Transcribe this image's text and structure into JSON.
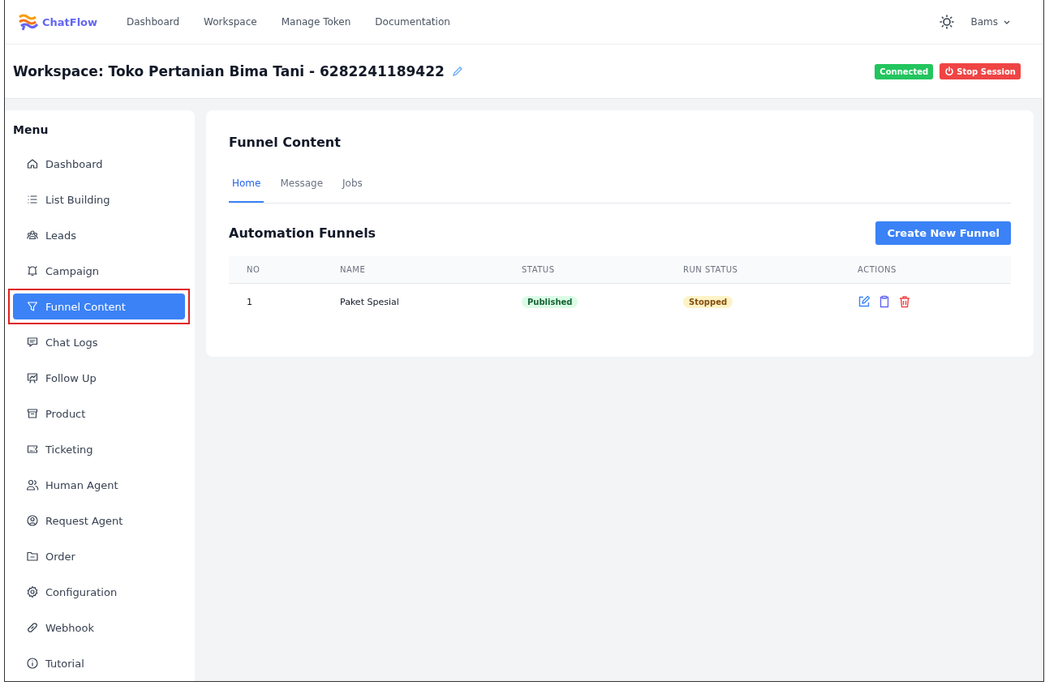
{
  "brand": {
    "name": "ChatFlow"
  },
  "nav": [
    {
      "label": "Dashboard"
    },
    {
      "label": "Workspace"
    },
    {
      "label": "Manage Token"
    },
    {
      "label": "Documentation"
    }
  ],
  "user": {
    "name": "Bams"
  },
  "workspace": {
    "title": "Workspace: Toko Pertanian Bima Tani - 6282241189422",
    "connection": "Connected",
    "stop_button": "Stop Session"
  },
  "sidebar": {
    "title": "Menu",
    "items": [
      {
        "label": "Dashboard",
        "selected": false,
        "highlighted": false
      },
      {
        "label": "List Building",
        "selected": false,
        "highlighted": false
      },
      {
        "label": "Leads",
        "selected": false,
        "highlighted": false
      },
      {
        "label": "Campaign",
        "selected": false,
        "highlighted": false
      },
      {
        "label": "Funnel Content",
        "selected": true,
        "highlighted": true
      },
      {
        "label": "Chat Logs",
        "selected": false,
        "highlighted": false
      },
      {
        "label": "Follow Up",
        "selected": false,
        "highlighted": false
      },
      {
        "label": "Product",
        "selected": false,
        "highlighted": false
      },
      {
        "label": "Ticketing",
        "selected": false,
        "highlighted": false
      },
      {
        "label": "Human Agent",
        "selected": false,
        "highlighted": false
      },
      {
        "label": "Request Agent",
        "selected": false,
        "highlighted": false
      },
      {
        "label": "Order",
        "selected": false,
        "highlighted": false
      },
      {
        "label": "Configuration",
        "selected": false,
        "highlighted": false
      },
      {
        "label": "Webhook",
        "selected": false,
        "highlighted": false
      },
      {
        "label": "Tutorial",
        "selected": false,
        "highlighted": false
      }
    ]
  },
  "page": {
    "title": "Funnel Content",
    "tabs": [
      {
        "label": "Home",
        "selected": true
      },
      {
        "label": "Message",
        "selected": false
      },
      {
        "label": "Jobs",
        "selected": false
      }
    ],
    "section_title": "Automation Funnels",
    "create_button": "Create New Funnel",
    "table": {
      "columns": [
        "NO",
        "NAME",
        "STATUS",
        "RUN STATUS",
        "ACTIONS"
      ],
      "rows": [
        {
          "no": "1",
          "name": "Paket Spesial",
          "status": "Published",
          "run_status": "Stopped"
        }
      ]
    }
  }
}
